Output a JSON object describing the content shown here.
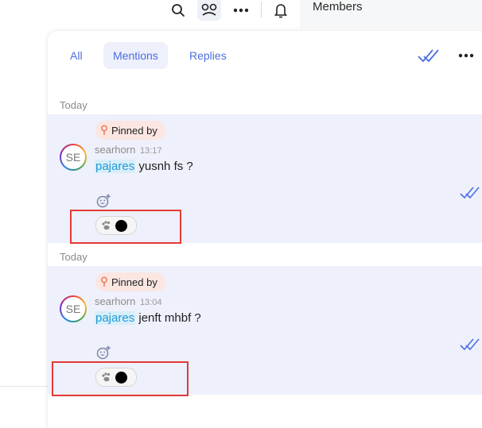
{
  "toolbar": {
    "icons": [
      "search-icon",
      "thread-icon",
      "more-icon",
      "bell-icon"
    ]
  },
  "members": {
    "title": "Members"
  },
  "tabs": [
    {
      "label": "All"
    },
    {
      "label": "Mentions",
      "active": true
    },
    {
      "label": "Replies"
    }
  ],
  "messages": [
    {
      "day": "Today",
      "pinned_label": "Pinned by",
      "avatar_initials": "SE",
      "author": "searhorn",
      "time": "13:17",
      "mention": "pajares",
      "text": " yusnh fs ?"
    },
    {
      "day": "Today",
      "pinned_label": "Pinned by",
      "avatar_initials": "SE",
      "author": "searhorn",
      "time": "13:04",
      "mention": "pajares",
      "text": " jenft mhbf ?"
    }
  ],
  "colors": {
    "accent": "#4b6fe0",
    "message_bg": "#eef0fb",
    "mention": "#1f9bd6",
    "highlight": "#e53935"
  }
}
